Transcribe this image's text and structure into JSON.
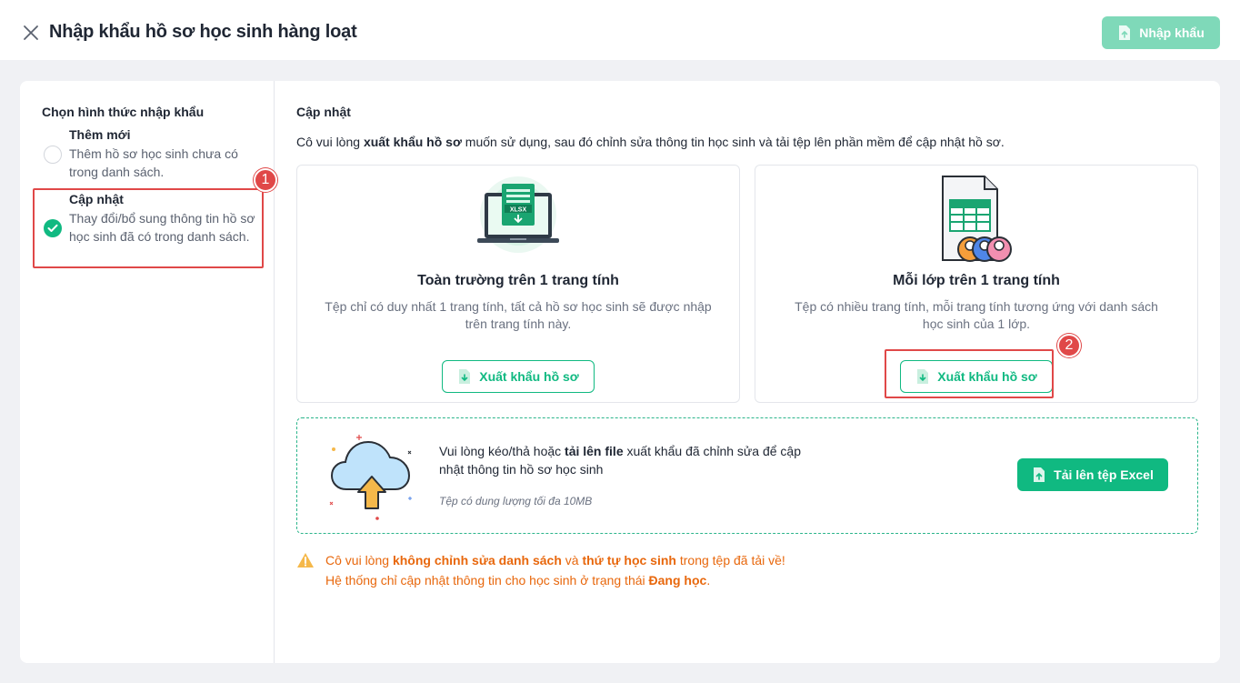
{
  "header": {
    "title": "Nhập khẩu hồ sơ học sinh hàng loạt",
    "import_button": "Nhập khẩu"
  },
  "sidebar": {
    "heading": "Chọn hình thức nhập khẩu",
    "options": [
      {
        "title": "Thêm mới",
        "desc": "Thêm hồ sơ học sinh chưa có trong danh sách.",
        "selected": false
      },
      {
        "title": "Cập nhật",
        "desc": "Thay đổi/bổ sung thông tin hồ sơ học sinh đã có trong danh sách.",
        "selected": true
      }
    ]
  },
  "annotations": {
    "badge1": "1",
    "badge2": "2"
  },
  "main": {
    "section_title": "Cập nhật",
    "intro_before": "Cô vui lòng ",
    "intro_bold": "xuất khẩu hồ sơ",
    "intro_after": " muốn sử dụng, sau đó chỉnh sửa thông tin học sinh và tải tệp lên phần mềm để cập nhật hồ sơ.",
    "cards": [
      {
        "title": "Toàn trường trên 1 trang tính",
        "desc": "Tệp chỉ có duy nhất 1 trang tính, tất cả hồ sơ học sinh sẽ được nhập trên trang tính này.",
        "button": "Xuất khẩu hồ sơ",
        "illus_label": "XLSX"
      },
      {
        "title": "Mỗi lớp trên 1 trang tính",
        "desc": "Tệp có nhiều trang tính, mỗi trang tính tương ứng với danh sách học sinh của 1 lớp.",
        "button": "Xuất khẩu hồ sơ"
      }
    ],
    "upload": {
      "text_before": "Vui lòng kéo/thả hoặc ",
      "text_bold": "tải lên file",
      "text_after": " xuất khẩu đã chỉnh sửa để cập nhật thông tin hồ sơ học sinh",
      "note": "Tệp có dung lượng tối đa 10MB",
      "button": "Tải lên tệp Excel"
    },
    "warning": {
      "l1_a": "Cô vui lòng ",
      "l1_b": "không chỉnh sửa danh sách",
      "l1_c": " và ",
      "l1_d": "thứ tự học sinh",
      "l1_e": " trong tệp đã tải về!",
      "l2_a": "Hệ thống chỉ cập nhật thông tin cho học sinh ở trạng thái ",
      "l2_b": "Đang học",
      "l2_c": "."
    }
  },
  "colors": {
    "primary": "#10b981",
    "primary_light": "#7fd9b9",
    "highlight": "#e04848",
    "warning": "#e8670c"
  }
}
